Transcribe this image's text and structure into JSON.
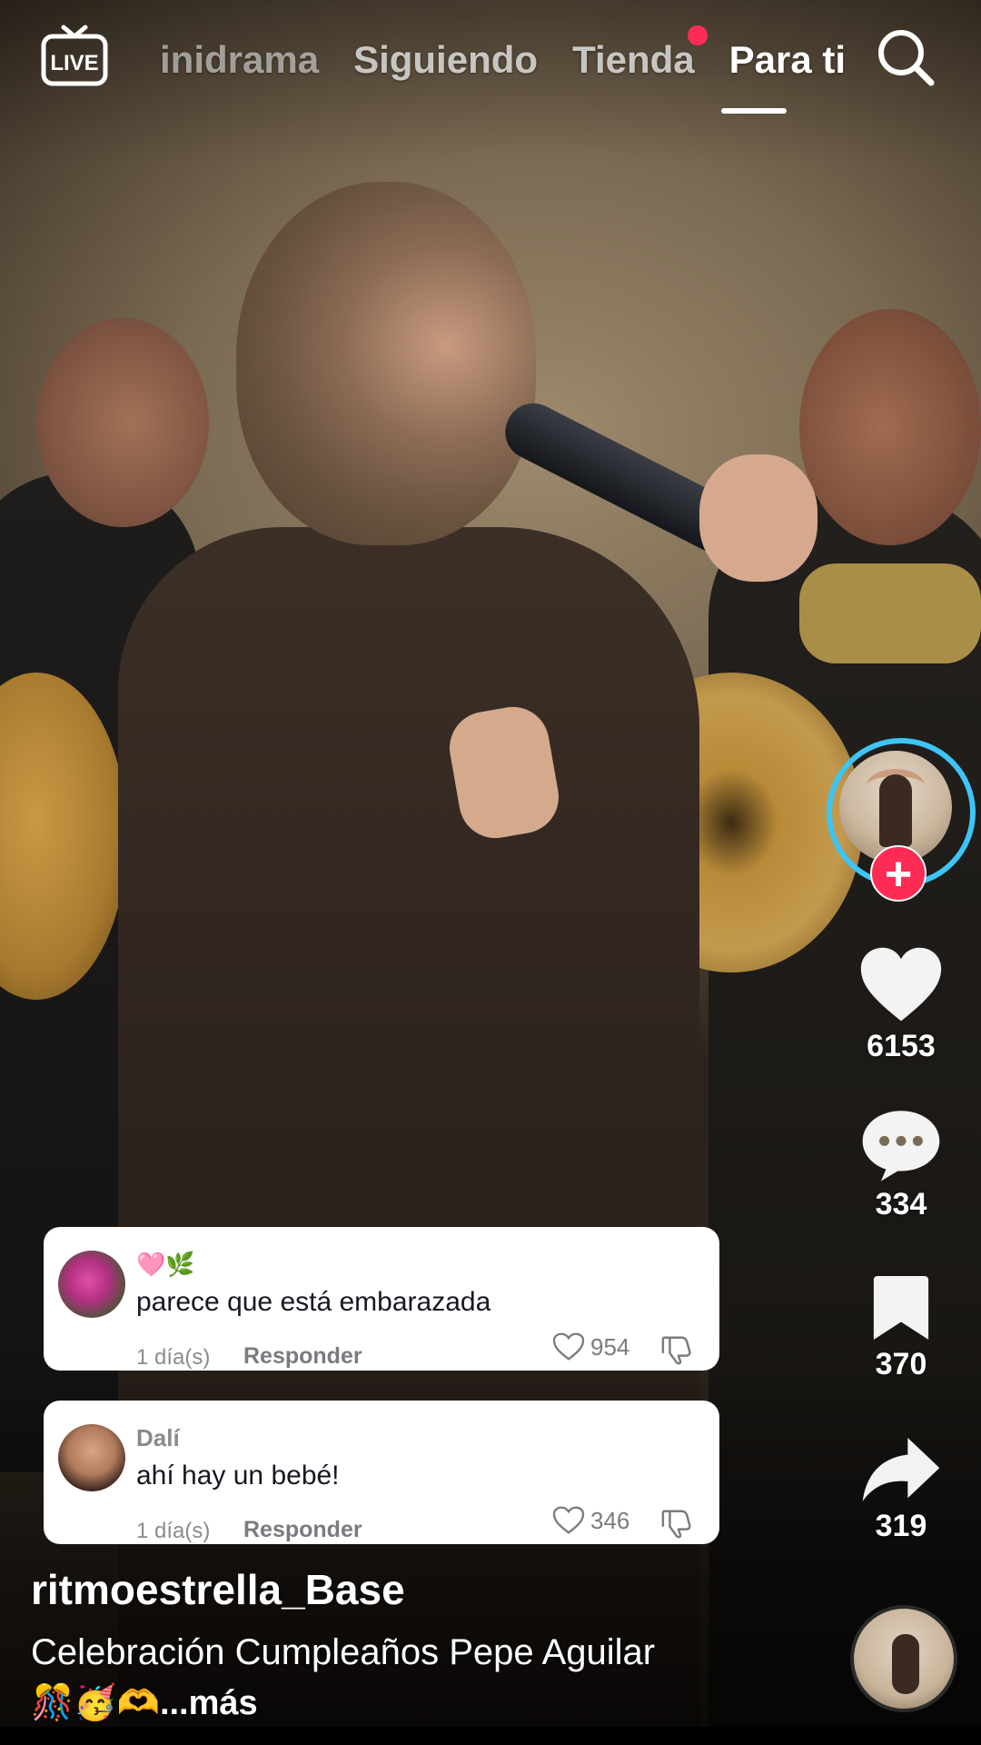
{
  "topbar": {
    "live_label": "LIVE",
    "tabs": [
      {
        "label": "inidrama",
        "active": false
      },
      {
        "label": "Siguiendo",
        "active": false
      },
      {
        "label": "Tienda",
        "active": false,
        "notification_dot": true
      },
      {
        "label": "Para ti",
        "active": true
      }
    ],
    "icons": {
      "live": "live-tv-icon",
      "search": "search-icon"
    }
  },
  "rail": {
    "profile": {
      "icon": "follow-plus-icon"
    },
    "like_count": "6153",
    "comment_count": "334",
    "save_count": "370",
    "share_count": "319",
    "icons": {
      "like": "heart-icon",
      "comment": "comment-icon",
      "save": "bookmark-icon",
      "share": "share-icon",
      "music": "music-disc-icon"
    }
  },
  "comments": [
    {
      "user": "",
      "emoji": "🩷🌿",
      "text": "parece que está embarazada",
      "time": "1 día(s)",
      "reply_label": "Responder",
      "likes": "954"
    },
    {
      "user": "Dalí",
      "emoji": "",
      "text": "ahí hay un bebé!",
      "time": "1 día(s)",
      "reply_label": "Responder",
      "likes": "346"
    }
  ],
  "post": {
    "username": "ritmoestrella_Base",
    "caption": "Celebración Cumpleaños Pepe Aguilar",
    "caption_more": "🎊🥳🫶...más"
  },
  "colors": {
    "accent": "#fe2c55",
    "story_ring": "#3ec4f5",
    "text_on_card": "#161823",
    "muted": "#8a8b91"
  }
}
